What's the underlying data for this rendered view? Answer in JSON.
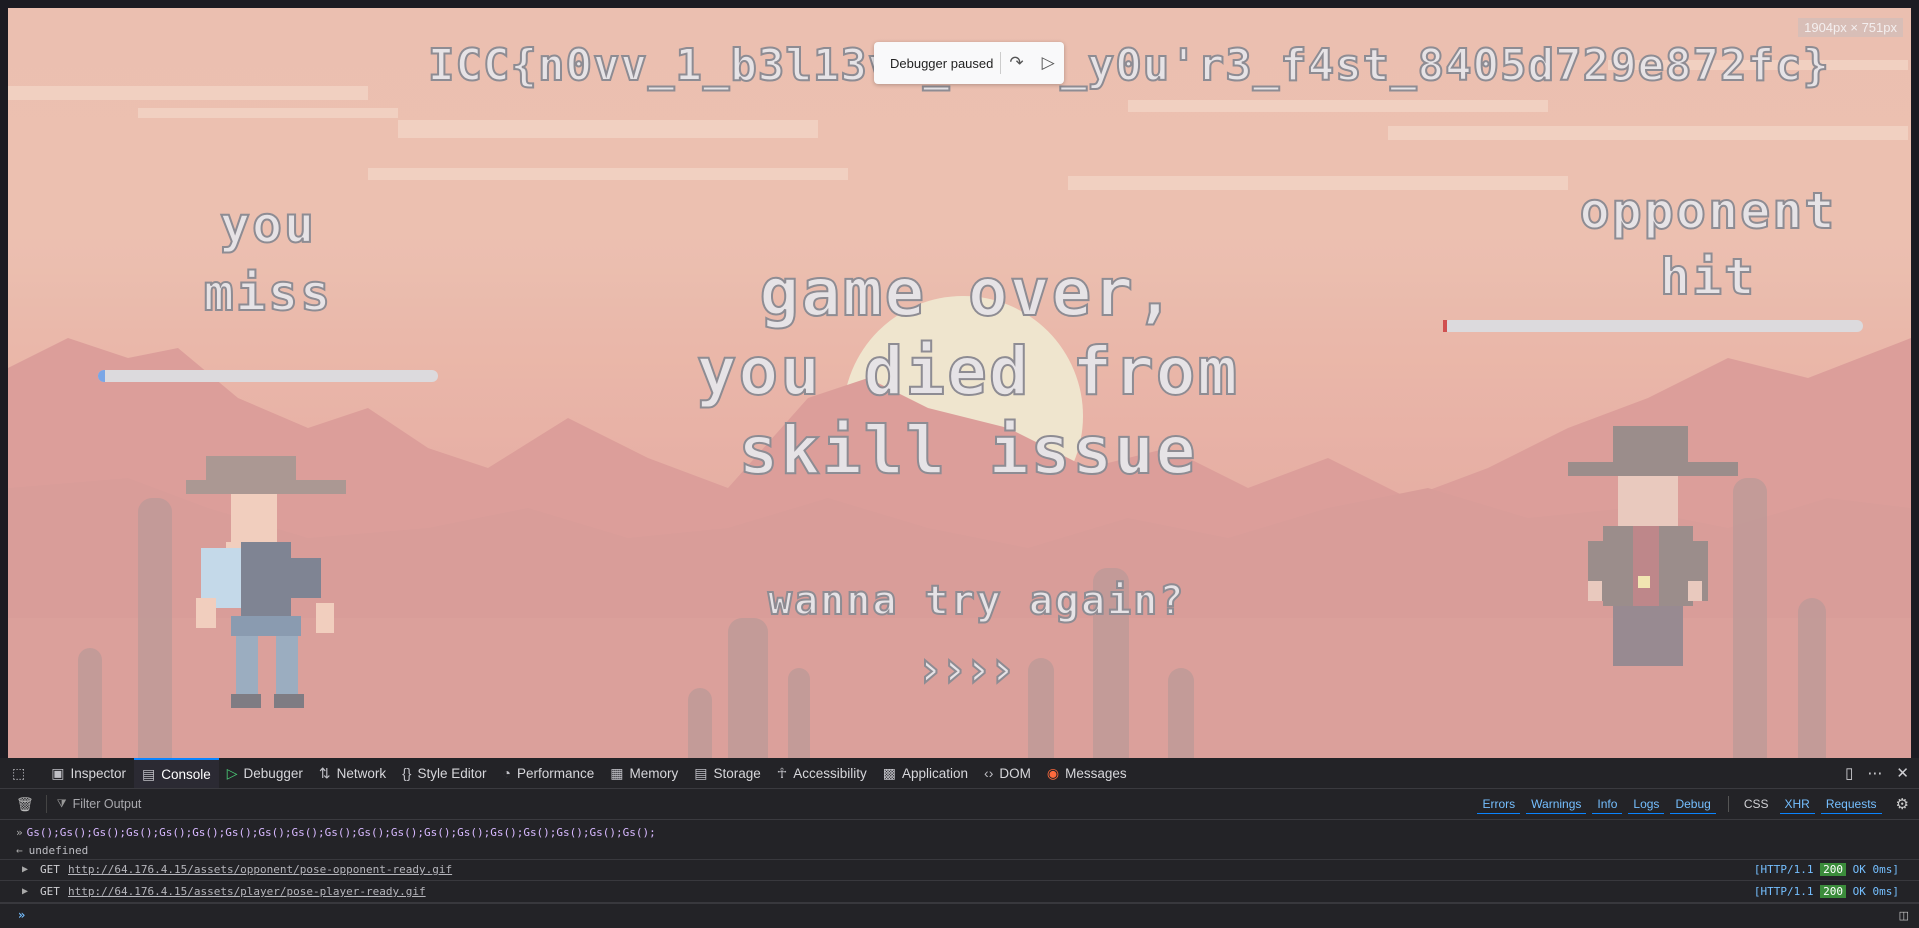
{
  "game": {
    "flag_text": "ICC{n0vv_1_b3l13v3_th4t_y0u'r3_f4st_8405d729e872fc}",
    "you_label_line1": "you",
    "you_label_line2": "miss",
    "opponent_label_line1": "opponent",
    "opponent_label_line2": "hit",
    "gameover_line1": "game over,",
    "gameover_line2": "you died from",
    "gameover_line3": "skill issue",
    "try_again": "wanna try again?",
    "try_again_arrows": "››››",
    "viewport_size": "1904px × 751px",
    "player_hp_fraction": 0.02,
    "opponent_hp_fraction": 0.01
  },
  "debugger_overlay": {
    "label": "Debugger paused",
    "step_over_icon": "step-over-icon",
    "resume_icon": "resume-icon"
  },
  "devtools": {
    "tabs": [
      {
        "label": "Inspector",
        "icon": "inspector-icon"
      },
      {
        "label": "Console",
        "icon": "console-icon",
        "active": true
      },
      {
        "label": "Debugger",
        "icon": "debugger-icon"
      },
      {
        "label": "Network",
        "icon": "network-icon"
      },
      {
        "label": "Style Editor",
        "icon": "style-editor-icon"
      },
      {
        "label": "Performance",
        "icon": "performance-icon"
      },
      {
        "label": "Memory",
        "icon": "memory-icon"
      },
      {
        "label": "Storage",
        "icon": "storage-icon"
      },
      {
        "label": "Accessibility",
        "icon": "accessibility-icon"
      },
      {
        "label": "Application",
        "icon": "application-icon"
      },
      {
        "label": "DOM",
        "icon": "dom-icon"
      },
      {
        "label": "Messages",
        "icon": "messages-icon"
      }
    ],
    "filter_placeholder": "Filter Output",
    "levels": [
      "Errors",
      "Warnings",
      "Info",
      "Logs",
      "Debug"
    ],
    "extra_filters": [
      "CSS",
      "XHR",
      "Requests"
    ],
    "console_input_echo": "Gs();Gs();Gs();Gs();Gs();Gs();Gs();Gs();Gs();Gs();Gs();Gs();Gs();Gs();Gs();Gs();Gs();Gs();Gs();",
    "console_result": "undefined",
    "requests": [
      {
        "method": "GET",
        "url": "http://64.176.4.15/assets/opponent/pose-opponent-ready.gif",
        "protocol": "[HTTP/1.1",
        "code": "200",
        "status": "OK 0ms]"
      },
      {
        "method": "GET",
        "url": "http://64.176.4.15/assets/player/pose-player-ready.gif",
        "protocol": "[HTTP/1.1",
        "code": "200",
        "status": "OK 0ms]"
      }
    ],
    "prompt_value": ""
  }
}
